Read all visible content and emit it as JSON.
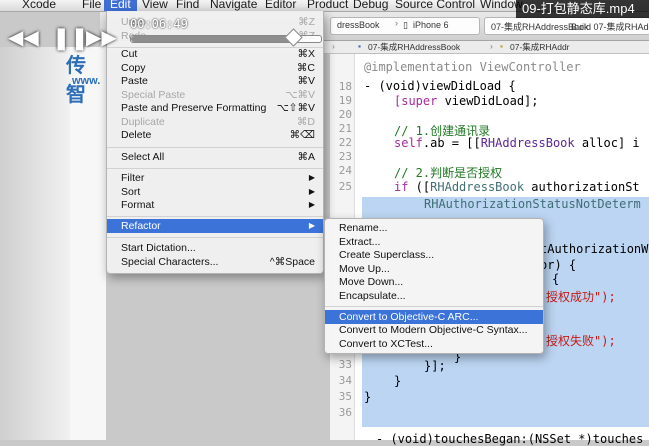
{
  "menubar": {
    "items": [
      {
        "label": "Xcode"
      },
      {
        "label": "File"
      },
      {
        "label": "Edit",
        "active": true
      },
      {
        "label": "View"
      },
      {
        "label": "Find"
      },
      {
        "label": "Navigate"
      },
      {
        "label": "Editor"
      },
      {
        "label": "Product"
      },
      {
        "label": "Debug"
      },
      {
        "label": "Source Control"
      },
      {
        "label": "Window"
      }
    ]
  },
  "video": {
    "title": "09-打包静态库.mp4",
    "time": "00:06:49",
    "progress": 0.85
  },
  "toolbar": {
    "scheme": "dressBook",
    "device": "iPhone 6",
    "tab_project": "07-集成RHAddressBook",
    "build_status": "Build 07-集成RHAddress"
  },
  "pathbar": {
    "crumb1": "07-集成RHAddressBook",
    "crumb2": "07-集成RHAddr"
  },
  "site": {
    "logo": "传智",
    "url": "www."
  },
  "edit_menu": {
    "undo": {
      "label": "Undo",
      "shortcut": "⌘Z"
    },
    "redo": {
      "label": "Redo",
      "shortcut": "⇧⌘Z"
    },
    "cut": {
      "label": "Cut",
      "shortcut": "⌘X"
    },
    "copy": {
      "label": "Copy",
      "shortcut": "⌘C"
    },
    "paste": {
      "label": "Paste",
      "shortcut": "⌘V"
    },
    "special_paste": {
      "label": "Special Paste",
      "shortcut": "⌥⌘V"
    },
    "paste_preserve": {
      "label": "Paste and Preserve Formatting",
      "shortcut": "⌥⇧⌘V"
    },
    "duplicate": {
      "label": "Duplicate",
      "shortcut": "⌘D"
    },
    "delete": {
      "label": "Delete",
      "shortcut": "⌘⌫"
    },
    "select_all": {
      "label": "Select All",
      "shortcut": "⌘A"
    },
    "filter": {
      "label": "Filter"
    },
    "sort": {
      "label": "Sort"
    },
    "format": {
      "label": "Format"
    },
    "refactor": {
      "label": "Refactor"
    },
    "start_dictation": {
      "label": "Start Dictation..."
    },
    "special_characters": {
      "label": "Special Characters...",
      "shortcut": "^⌘Space"
    }
  },
  "refactor_menu": {
    "rename": "Rename...",
    "extract": "Extract...",
    "create_superclass": "Create Superclass...",
    "move_up": "Move Up...",
    "move_down": "Move Down...",
    "encapsulate": "Encapsulate...",
    "convert_arc": "Convert to Objective-C ARC...",
    "convert_modern": "Convert to Modern Objective-C Syntax...",
    "convert_xctest": "Convert to XCTest..."
  },
  "editor": {
    "line_numbers": [
      "",
      "18",
      "19",
      "20",
      "21",
      "22",
      "23",
      "24",
      "25",
      "",
      "",
      "",
      "",
      "",
      "",
      "",
      "",
      "",
      "",
      "",
      "33",
      "34",
      "35",
      "36",
      "",
      ""
    ],
    "lines": {
      "l0": "@implementation ViewController",
      "l18": "- (void)viewDidLoad {",
      "l19_a": "[super ",
      "l19_b": "viewDidLoad];",
      "l21": "// 1.创建通讯录",
      "l22_a": "self",
      "l22_b": ".ab = [[",
      "l22_c": "RHAddressBook",
      "l22_d": " alloc] i",
      "l24": "// 2.判断是否授权",
      "l25_a": "if",
      "l25_b": " ([",
      "l25_c": "RHAddressBook",
      "l25_d": " authorizationSt",
      "l26": "RHAuthorizationStatusNotDeterm",
      "l28": "tAuthorizationW",
      "l29": "or) {",
      "l30": "{",
      "l31": "授权成功\");",
      "l33": "授权失败\");",
      "l34": "}",
      "l35": "}];",
      "l36": "}",
      "l38": "}",
      "l40": "- (void)touchesBegan:(NSSet *)touches"
    }
  },
  "colors": {
    "menu_highlight": "#3b73d9",
    "selection": "#bcd5f2",
    "comment": "#1f7a22",
    "keyword": "#a52a9e"
  }
}
